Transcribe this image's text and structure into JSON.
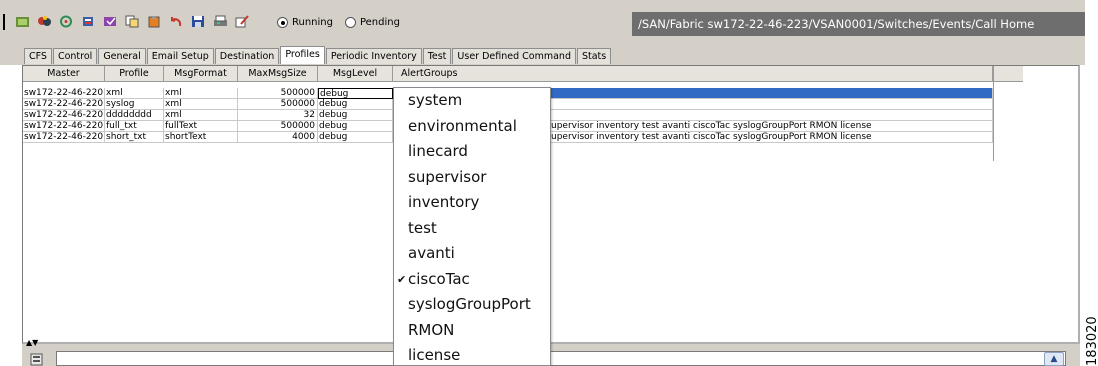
{
  "toolbar": {
    "icons": [
      "refresh-icon",
      "devices-icon",
      "discovery-icon",
      "export-icon",
      "apply-icon",
      "copy-icon",
      "paste-icon",
      "undo-icon",
      "save-icon",
      "print-icon",
      "edit-icon"
    ],
    "radio_running": "Running",
    "radio_pending": "Pending",
    "selected_mode": "Running",
    "path": "/SAN/Fabric sw172-22-46-223/VSAN0001/Switches/Events/Call Home"
  },
  "tabs": [
    "CFS",
    "Control",
    "General",
    "Email Setup",
    "Destination",
    "Profiles",
    "Periodic Inventory",
    "Test",
    "User Defined Command",
    "Stats"
  ],
  "active_tab": "Profiles",
  "table": {
    "headers": [
      "Master",
      "Profile",
      "MsgFormat",
      "MaxMsgSize",
      "MsgLevel",
      "AlertGroups"
    ],
    "rows": [
      {
        "master": "sw172-22-46-220",
        "profile": "xml",
        "format": "xml",
        "size": "500000",
        "level": "debug",
        "groups": ""
      },
      {
        "master": "sw172-22-46-220",
        "profile": "syslog",
        "format": "xml",
        "size": "500000",
        "level": "debug",
        "groups": ""
      },
      {
        "master": "sw172-22-46-220",
        "profile": "dddddddd",
        "format": "xml",
        "size": "32",
        "level": "debug",
        "groups": ""
      },
      {
        "master": "sw172-22-46-220",
        "profile": "full_txt",
        "format": "fullText",
        "size": "500000",
        "level": "debug",
        "groups": "upervisor inventory test avanti ciscoTac syslogGroupPort RMON license"
      },
      {
        "master": "sw172-22-46-220",
        "profile": "short_txt",
        "format": "shortText",
        "size": "4000",
        "level": "debug",
        "groups": "upervisor inventory test avanti ciscoTac syslogGroupPort RMON license"
      }
    ]
  },
  "dropdown": {
    "items": [
      "system",
      "environmental",
      "linecard",
      "supervisor",
      "inventory",
      "test",
      "avanti",
      "ciscoTac",
      "syslogGroupPort",
      "RMON",
      "license"
    ],
    "checked": [
      "ciscoTac"
    ]
  },
  "figure_id": "183020",
  "colors": {
    "selection": "#316ac5",
    "path_bar": "#6e6e6e",
    "chrome": "#d4d0c8"
  }
}
